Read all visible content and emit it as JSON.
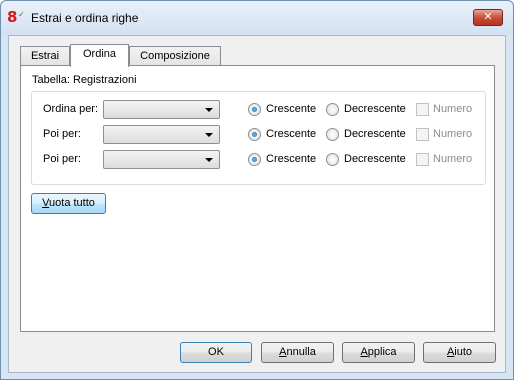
{
  "window": {
    "title": "Estrai e ordina righe",
    "close_glyph": "✕",
    "app_icon": "8"
  },
  "tabs": [
    {
      "label": "Estrai"
    },
    {
      "label": "Ordina"
    },
    {
      "label": "Composizione"
    }
  ],
  "panel": {
    "table_label": "Tabella: Registrazioni",
    "rows": [
      {
        "label": "Ordina per:",
        "combo_value": "",
        "asc": "Crescente",
        "desc": "Decrescente",
        "numeric": "Numero",
        "selected": "asc",
        "numeric_checked": false
      },
      {
        "label": "Poi per:",
        "combo_value": "",
        "asc": "Crescente",
        "desc": "Decrescente",
        "numeric": "Numero",
        "selected": "asc",
        "numeric_checked": false
      },
      {
        "label": "Poi per:",
        "combo_value": "",
        "asc": "Crescente",
        "desc": "Decrescente",
        "numeric": "Numero",
        "selected": "asc",
        "numeric_checked": false
      }
    ],
    "clear_button": "Vuota tutto"
  },
  "footer": {
    "ok": "OK",
    "cancel": "Annulla",
    "apply": "Applica",
    "help": "Aiuto"
  },
  "colors": {
    "accent": "#3c7fb1",
    "close": "#c74e3a",
    "frame": "#d7e4f2"
  }
}
